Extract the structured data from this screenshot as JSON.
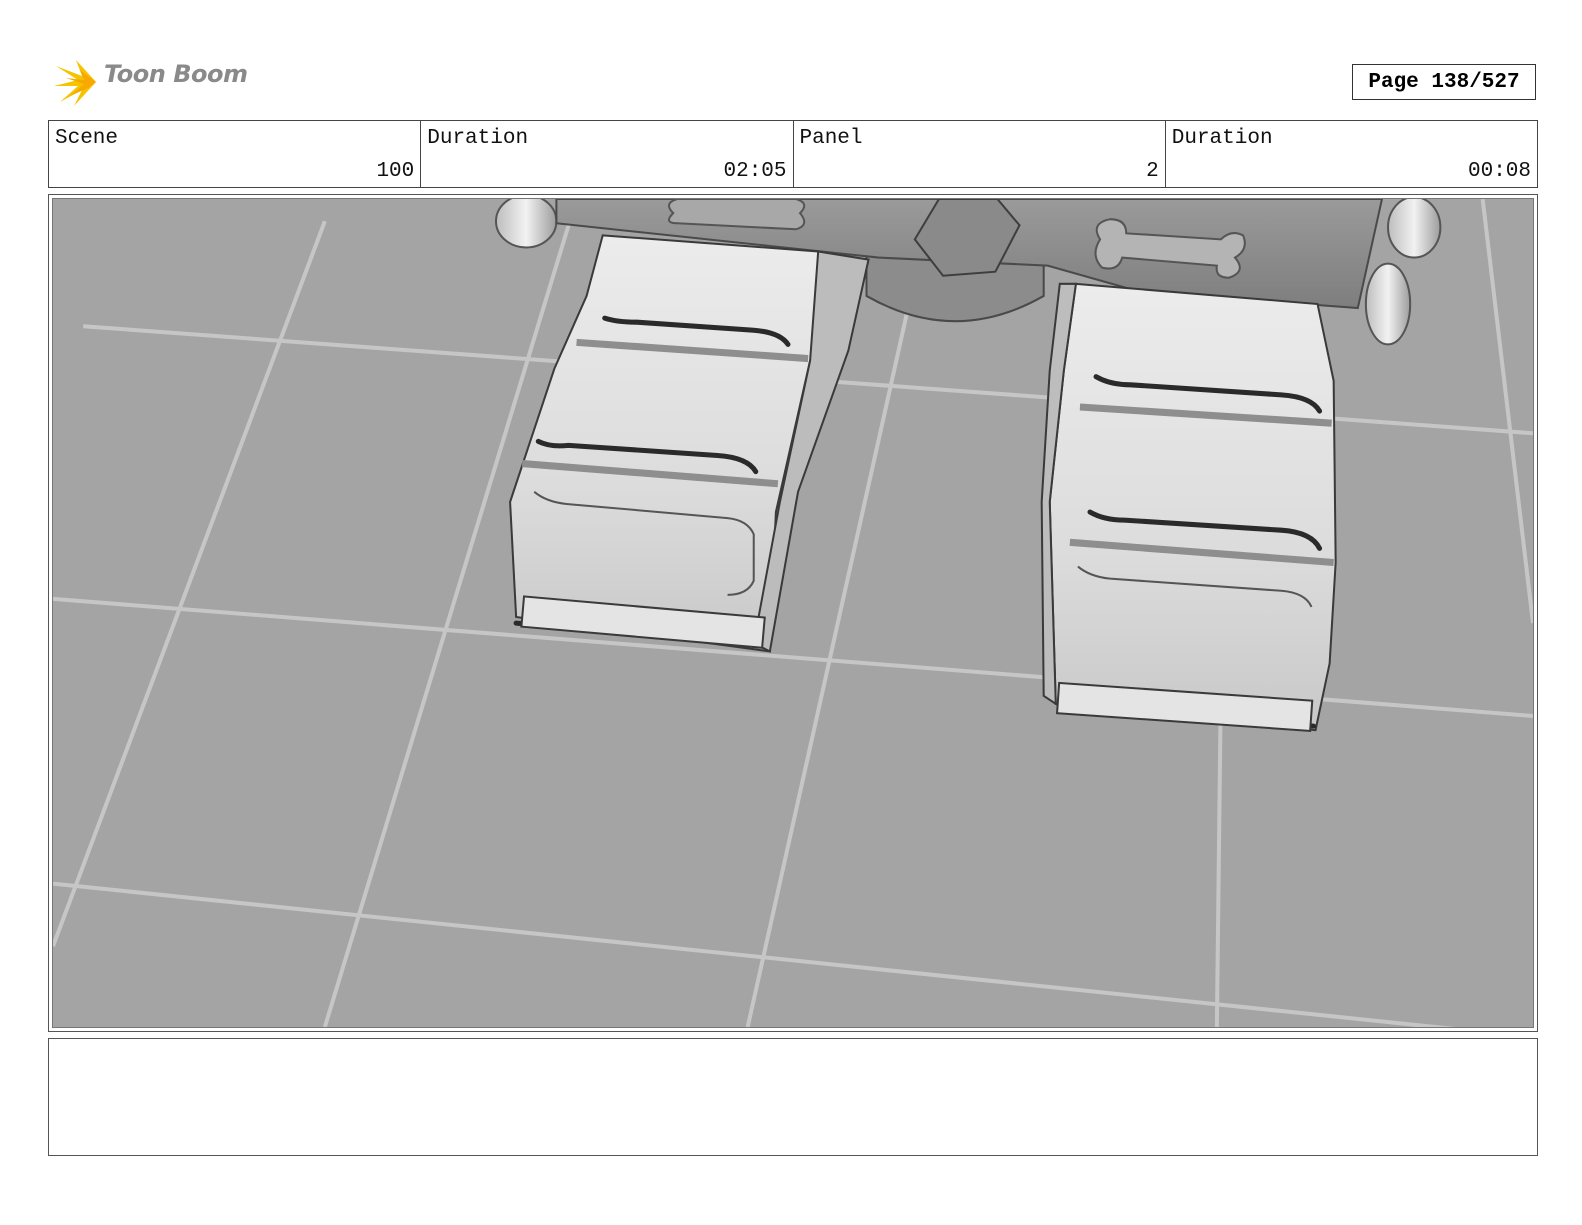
{
  "header": {
    "logo_text": "Toon Boom",
    "page_label": "Page 138/527"
  },
  "info": {
    "scene_label": "Scene",
    "scene_value": "100",
    "scene_duration_label": "Duration",
    "scene_duration_value": "02:05",
    "panel_label": "Panel",
    "panel_value": "2",
    "panel_duration_label": "Duration",
    "panel_duration_value": "00:08"
  },
  "colors": {
    "floor": "#a4a4a4",
    "grid_line": "#c4c4c4",
    "model_light": "#e8e8e8",
    "model_dark": "#2a2a2a",
    "logo_yellow": "#f5c400"
  },
  "notes": ""
}
